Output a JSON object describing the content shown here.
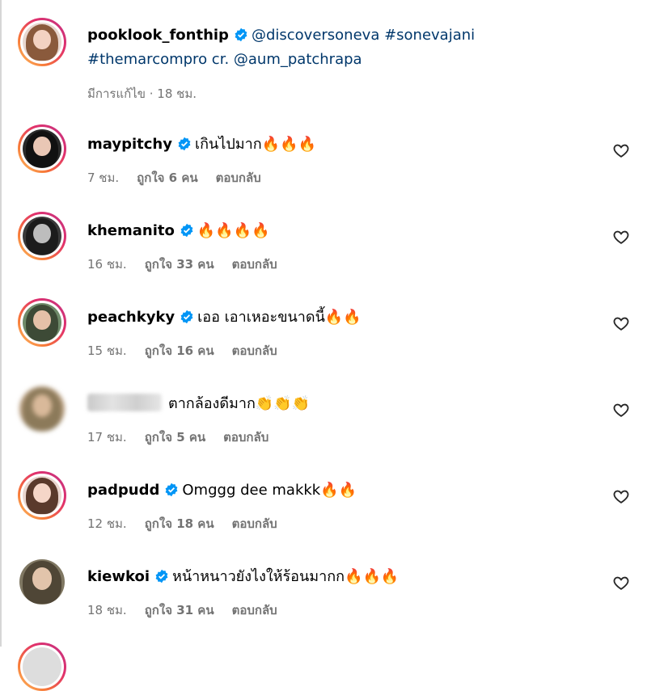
{
  "post": {
    "username": "pooklook_fonthip",
    "caption_line1": "@discoversoneva #sonevajani",
    "caption_line2": "#themarcompro cr. @aum_patchrapa",
    "meta": "มีการแก้ไข · 18 ชม."
  },
  "labels": {
    "reply": "ตอบกลับ"
  },
  "colors": {
    "link": "#00376b",
    "meta": "#737373",
    "verified": "#0095f6",
    "ring_start": "#fdc468",
    "ring_end": "#c13584"
  },
  "comments": [
    {
      "username": "maypitchy",
      "text": "เกินไปมาก🔥🔥🔥",
      "time": "7 ชม.",
      "likes": "ถูกใจ 6 คน",
      "verified": true
    },
    {
      "username": "khemanito",
      "text": "🔥🔥🔥🔥",
      "time": "16 ชม.",
      "likes": "ถูกใจ 33 คน",
      "verified": true
    },
    {
      "username": "peachkyky",
      "text": "เออ เอาเหอะขนาดนี้🔥🔥",
      "time": "15 ชม.",
      "likes": "ถูกใจ 16 คน",
      "verified": true
    },
    {
      "username": "",
      "text": "ตากล้องดีมาก👏👏👏",
      "time": "17 ชม.",
      "likes": "ถูกใจ 5 คน",
      "verified": false
    },
    {
      "username": "padpudd",
      "text": "Omggg dee makkk🔥🔥",
      "time": "12 ชม.",
      "likes": "ถูกใจ 18 คน",
      "verified": true
    },
    {
      "username": "kiewkoi",
      "text": "หน้าหนาวยังไงให้ร้อนมากก🔥🔥🔥",
      "time": "18 ชม.",
      "likes": "ถูกใจ 31 คน",
      "verified": true
    }
  ],
  "icons": {
    "verified": "verified-badge-icon",
    "like": "heart-outline-icon"
  }
}
